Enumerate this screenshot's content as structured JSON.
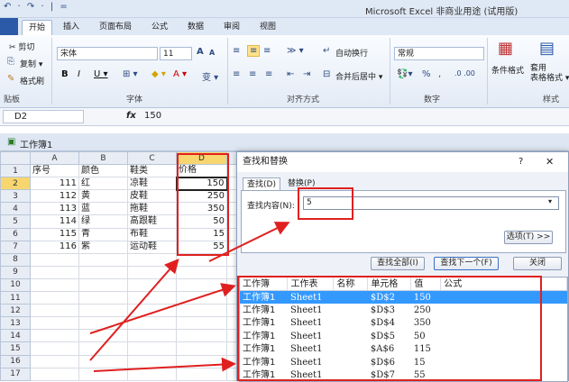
{
  "qat": "↶ · ↷ · | =",
  "app_title": "Microsoft Excel 非商业用途 (试用版)",
  "tabs": [
    "开始",
    "插入",
    "页面布局",
    "公式",
    "数据",
    "审阅",
    "视图"
  ],
  "ribbon": {
    "cut": "✂ 剪切",
    "copy": "复制 ▾",
    "format_painter": "格式刷",
    "clipboard_group": "贴板",
    "font_name": "宋体",
    "font_size": "11",
    "font_group": "字体",
    "bold": "B",
    "italic": "I",
    "underline": "U ▾",
    "grow_font": "A",
    "shrink_font": "A",
    "wrap_text": "自动换行",
    "merge_center": "合并后居中 ▾",
    "align_group": "对齐方式",
    "number_format": "常规",
    "number_group": "数字",
    "percent": "%",
    "comma": ",",
    "cond_format": "条件格式",
    "table_format": "套用\n表格格式 ▾",
    "styles_group": "样式"
  },
  "formula": {
    "namebox": "D2",
    "fx": "fx",
    "value": "150"
  },
  "workbook_title": "工作簿1",
  "columns": [
    "A",
    "B",
    "C",
    "D"
  ],
  "rows": [
    {
      "n": "1",
      "a": "序号",
      "b": "颜色",
      "c": "鞋类",
      "d": "价格"
    },
    {
      "n": "2",
      "a": "111",
      "b": "红",
      "c": "凉鞋",
      "d": "150"
    },
    {
      "n": "3",
      "a": "112",
      "b": "黄",
      "c": "皮鞋",
      "d": "250"
    },
    {
      "n": "4",
      "a": "113",
      "b": "蓝",
      "c": "拖鞋",
      "d": "350"
    },
    {
      "n": "5",
      "a": "114",
      "b": "绿",
      "c": "高跟鞋",
      "d": "50"
    },
    {
      "n": "6",
      "a": "115",
      "b": "青",
      "c": "布鞋",
      "d": "15"
    },
    {
      "n": "7",
      "a": "116",
      "b": "紫",
      "c": "运动鞋",
      "d": "55"
    },
    {
      "n": "8",
      "a": "",
      "b": "",
      "c": "",
      "d": ""
    },
    {
      "n": "9",
      "a": "",
      "b": "",
      "c": "",
      "d": ""
    },
    {
      "n": "10",
      "a": "",
      "b": "",
      "c": "",
      "d": ""
    },
    {
      "n": "11",
      "a": "",
      "b": "",
      "c": "",
      "d": ""
    },
    {
      "n": "12",
      "a": "",
      "b": "",
      "c": "",
      "d": ""
    },
    {
      "n": "13",
      "a": "",
      "b": "",
      "c": "",
      "d": ""
    },
    {
      "n": "14",
      "a": "",
      "b": "",
      "c": "",
      "d": ""
    },
    {
      "n": "15",
      "a": "",
      "b": "",
      "c": "",
      "d": ""
    },
    {
      "n": "16",
      "a": "",
      "b": "",
      "c": "",
      "d": ""
    },
    {
      "n": "17",
      "a": "",
      "b": "",
      "c": "",
      "d": ""
    },
    {
      "n": "18",
      "a": "",
      "b": "",
      "c": "",
      "d": ""
    }
  ],
  "dialog": {
    "title": "查找和替换",
    "help": "?",
    "close": "✕",
    "tab_find": "查找(D)",
    "tab_replace": "替换(P)",
    "find_label": "查找内容(N):",
    "find_value": "5",
    "options_btn": "选项(T) >>",
    "find_all": "查找全部(I)",
    "find_next": "查找下一个(F)",
    "close_btn": "关闭",
    "headers": [
      "工作簿",
      "工作表",
      "名称",
      "单元格",
      "值",
      "公式"
    ],
    "results": [
      [
        "工作簿1",
        "Sheet1",
        "",
        "$D$2",
        "150",
        ""
      ],
      [
        "工作簿1",
        "Sheet1",
        "",
        "$D$3",
        "250",
        ""
      ],
      [
        "工作簿1",
        "Sheet1",
        "",
        "$D$4",
        "350",
        ""
      ],
      [
        "工作簿1",
        "Sheet1",
        "",
        "$D$5",
        "50",
        ""
      ],
      [
        "工作簿1",
        "Sheet1",
        "",
        "$A$6",
        "115",
        ""
      ],
      [
        "工作簿1",
        "Sheet1",
        "",
        "$D$6",
        "15",
        ""
      ],
      [
        "工作簿1",
        "Sheet1",
        "",
        "$D$7",
        "55",
        ""
      ]
    ]
  },
  "colors": {
    "accent": "#2a5aa8",
    "highlight": "#3399ff",
    "annotation": "#e02020"
  }
}
